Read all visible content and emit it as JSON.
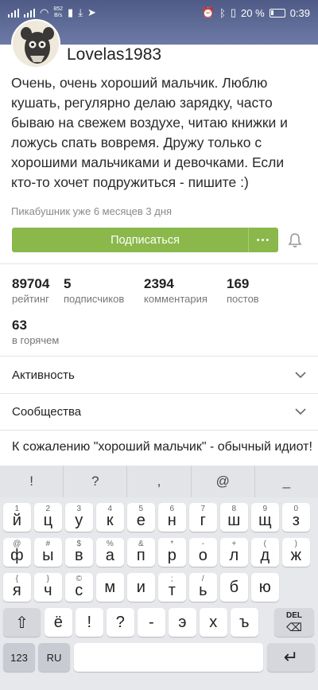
{
  "status": {
    "net_speed": "852\nB/s",
    "battery_percent": "20 %",
    "time": "0:39"
  },
  "profile": {
    "username": "Lovelas1983",
    "bio": "Очень, очень хороший мальчик. Люблю кушать, регулярно делаю зарядку, часто бываю на свежем воздухе, читаю книжки и ложусь спать вовремя. Дружу только с хорошими мальчиками и девочками. Если кто-то хочет подружиться - пишите :)",
    "since": "Пикабушник уже 6 месяцев 3 дня",
    "subscribe_label": "Подписаться",
    "more_label": "•••"
  },
  "stats": [
    {
      "value": "89704",
      "label": "рейтинг"
    },
    {
      "value": "5",
      "label": "подписчиков"
    },
    {
      "value": "2394",
      "label": "комментария"
    },
    {
      "value": "169",
      "label": "постов"
    },
    {
      "value": "63",
      "label": "в горячем"
    }
  ],
  "sections": {
    "activity": "Активность",
    "communities": "Сообщества"
  },
  "comment_input": {
    "value": "К сожалению \"хороший мальчик\" - обычный идиот!"
  },
  "keyboard": {
    "suggestions": [
      "!",
      "?",
      ",",
      "@",
      "_"
    ],
    "row1": [
      [
        "1",
        "й"
      ],
      [
        "2",
        "ц"
      ],
      [
        "3",
        "у"
      ],
      [
        "4",
        "к"
      ],
      [
        "5",
        "е"
      ],
      [
        "6",
        "н"
      ],
      [
        "7",
        "г"
      ],
      [
        "8",
        "ш"
      ],
      [
        "9",
        "щ"
      ],
      [
        "0",
        "з"
      ]
    ],
    "row2": [
      [
        "@",
        "ф"
      ],
      [
        "#",
        "ы"
      ],
      [
        "$",
        "в"
      ],
      [
        "%",
        "а"
      ],
      [
        "&",
        "п"
      ],
      [
        "*",
        "р"
      ],
      [
        "-",
        "о"
      ],
      [
        "+",
        "л"
      ],
      [
        "(",
        "д"
      ],
      [
        ")",
        "ж"
      ]
    ],
    "row3": [
      [
        "{",
        "я"
      ],
      [
        "}",
        "ч"
      ],
      [
        "©",
        "с"
      ],
      [
        "",
        "м"
      ],
      [
        "",
        "и"
      ],
      [
        ";",
        "т"
      ],
      [
        "/",
        "ь"
      ],
      [
        "",
        "б"
      ],
      [
        "",
        "ю"
      ]
    ],
    "row4": [
      "ё",
      "!",
      "?",
      "-",
      "э",
      "х",
      "ъ"
    ],
    "row4_extra": "э",
    "bottom": {
      "numbers": "123",
      "lang": "RU"
    },
    "del_label": "DEL",
    "colors": {
      "bg": "#e7e8ec",
      "key": "#ffffff",
      "fn_key": "#c9cbd2"
    }
  },
  "colors": {
    "accent": "#8ab84a",
    "header": "#5a6690"
  }
}
